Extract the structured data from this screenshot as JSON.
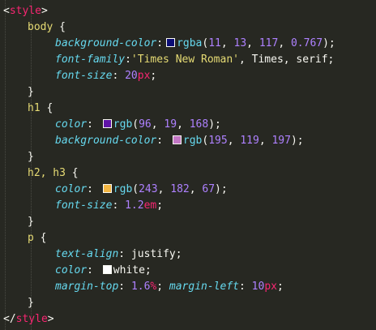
{
  "lines": [
    {
      "indent": 0,
      "tokens": [
        {
          "c": "tag-br",
          "t": "<"
        },
        {
          "c": "tag-name",
          "t": "style"
        },
        {
          "c": "tag-br",
          "t": ">"
        }
      ]
    },
    {
      "indent": 1,
      "tokens": [
        {
          "c": "sel",
          "t": "body"
        },
        {
          "c": "brace",
          "t": " {"
        }
      ]
    },
    {
      "indent": 2,
      "tokens": [
        {
          "c": "prop",
          "t": "background-color"
        },
        {
          "c": "punc",
          "t": ":"
        },
        {
          "c": "swatch",
          "color": "#0b0d75"
        },
        {
          "c": "fn",
          "t": "rgba"
        },
        {
          "c": "punc",
          "t": "("
        },
        {
          "c": "num",
          "t": "11"
        },
        {
          "c": "punc",
          "t": ", "
        },
        {
          "c": "num",
          "t": "13"
        },
        {
          "c": "punc",
          "t": ", "
        },
        {
          "c": "num",
          "t": "117"
        },
        {
          "c": "punc",
          "t": ", "
        },
        {
          "c": "num",
          "t": "0.767"
        },
        {
          "c": "punc",
          "t": ");"
        }
      ]
    },
    {
      "indent": 2,
      "tokens": [
        {
          "c": "prop",
          "t": "font-family"
        },
        {
          "c": "punc",
          "t": ":"
        },
        {
          "c": "str",
          "t": "'Times New Roman'"
        },
        {
          "c": "punc",
          "t": ", Times, serif;"
        }
      ]
    },
    {
      "indent": 2,
      "tokens": [
        {
          "c": "prop",
          "t": "font-size"
        },
        {
          "c": "punc",
          "t": ": "
        },
        {
          "c": "num",
          "t": "20"
        },
        {
          "c": "unit",
          "t": "px"
        },
        {
          "c": "punc",
          "t": ";"
        }
      ]
    },
    {
      "indent": 1,
      "tokens": [
        {
          "c": "brace",
          "t": "}"
        }
      ]
    },
    {
      "indent": 1,
      "tokens": [
        {
          "c": "sel",
          "t": "h1"
        },
        {
          "c": "brace",
          "t": " {"
        }
      ]
    },
    {
      "indent": 2,
      "tokens": [
        {
          "c": "prop",
          "t": "color"
        },
        {
          "c": "punc",
          "t": ": "
        },
        {
          "c": "swatch",
          "color": "#6013a8"
        },
        {
          "c": "fn",
          "t": "rgb"
        },
        {
          "c": "punc",
          "t": "("
        },
        {
          "c": "num",
          "t": "96"
        },
        {
          "c": "punc",
          "t": ", "
        },
        {
          "c": "num",
          "t": "19"
        },
        {
          "c": "punc",
          "t": ", "
        },
        {
          "c": "num",
          "t": "168"
        },
        {
          "c": "punc",
          "t": ");"
        }
      ]
    },
    {
      "indent": 2,
      "tokens": [
        {
          "c": "prop",
          "t": "background-color"
        },
        {
          "c": "punc",
          "t": ": "
        },
        {
          "c": "swatch",
          "color": "#c377c5"
        },
        {
          "c": "fn",
          "t": "rgb"
        },
        {
          "c": "punc",
          "t": "("
        },
        {
          "c": "num",
          "t": "195"
        },
        {
          "c": "punc",
          "t": ", "
        },
        {
          "c": "num",
          "t": "119"
        },
        {
          "c": "punc",
          "t": ", "
        },
        {
          "c": "num",
          "t": "197"
        },
        {
          "c": "punc",
          "t": ");"
        }
      ]
    },
    {
      "indent": 1,
      "tokens": [
        {
          "c": "brace",
          "t": "}"
        }
      ]
    },
    {
      "indent": 1,
      "tokens": [
        {
          "c": "sel",
          "t": "h2, h3"
        },
        {
          "c": "brace",
          "t": " {"
        }
      ]
    },
    {
      "indent": 2,
      "tokens": [
        {
          "c": "prop",
          "t": "color"
        },
        {
          "c": "punc",
          "t": ": "
        },
        {
          "c": "swatch",
          "color": "#f3b643"
        },
        {
          "c": "fn",
          "t": "rgb"
        },
        {
          "c": "punc",
          "t": "("
        },
        {
          "c": "num",
          "t": "243"
        },
        {
          "c": "punc",
          "t": ", "
        },
        {
          "c": "num",
          "t": "182"
        },
        {
          "c": "punc",
          "t": ", "
        },
        {
          "c": "num",
          "t": "67"
        },
        {
          "c": "punc",
          "t": ");"
        }
      ]
    },
    {
      "indent": 2,
      "tokens": [
        {
          "c": "prop",
          "t": "font-size"
        },
        {
          "c": "punc",
          "t": ": "
        },
        {
          "c": "num",
          "t": "1.2"
        },
        {
          "c": "unit",
          "t": "em"
        },
        {
          "c": "punc",
          "t": ";"
        }
      ]
    },
    {
      "indent": 1,
      "tokens": [
        {
          "c": "brace",
          "t": "}"
        }
      ]
    },
    {
      "indent": 1,
      "tokens": [
        {
          "c": "sel",
          "t": "p"
        },
        {
          "c": "brace",
          "t": " {"
        }
      ]
    },
    {
      "indent": 2,
      "tokens": [
        {
          "c": "prop",
          "t": "text-align"
        },
        {
          "c": "punc",
          "t": ": justify;"
        }
      ]
    },
    {
      "indent": 2,
      "tokens": [
        {
          "c": "prop",
          "t": "color"
        },
        {
          "c": "punc",
          "t": ": "
        },
        {
          "c": "swatch",
          "color": "#ffffff"
        },
        {
          "c": "punc",
          "t": "white;"
        }
      ]
    },
    {
      "indent": 2,
      "tokens": [
        {
          "c": "prop",
          "t": "margin-top"
        },
        {
          "c": "punc",
          "t": ": "
        },
        {
          "c": "num",
          "t": "1.6"
        },
        {
          "c": "unit",
          "t": "%"
        },
        {
          "c": "punc",
          "t": "; "
        },
        {
          "c": "prop",
          "t": "margin-left"
        },
        {
          "c": "punc",
          "t": ": "
        },
        {
          "c": "num",
          "t": "10"
        },
        {
          "c": "unit",
          "t": "px"
        },
        {
          "c": "punc",
          "t": ";"
        }
      ]
    },
    {
      "indent": 1,
      "tokens": [
        {
          "c": "brace",
          "t": "}"
        }
      ]
    },
    {
      "indent": 0,
      "tokens": [
        {
          "c": "tag-br",
          "t": "</"
        },
        {
          "c": "tag-name",
          "t": "style"
        },
        {
          "c": "tag-br",
          "t": ">"
        }
      ]
    }
  ]
}
